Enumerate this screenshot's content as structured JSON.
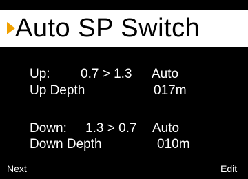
{
  "title": {
    "cursor_icon": "right-triangle-cursor-icon",
    "cursor_color": "#f0a000",
    "text": "Auto SP Switch"
  },
  "up": {
    "label": "Up:",
    "range": "0.7 > 1.3",
    "mode": "Auto",
    "depth_label": "Up Depth",
    "depth_value": "017m"
  },
  "down": {
    "label": "Down:",
    "range": "1.3 > 0.7",
    "mode": "Auto",
    "depth_label": "Down Depth",
    "depth_value": "010m"
  },
  "softkeys": {
    "left": "Next",
    "right": "Edit"
  }
}
